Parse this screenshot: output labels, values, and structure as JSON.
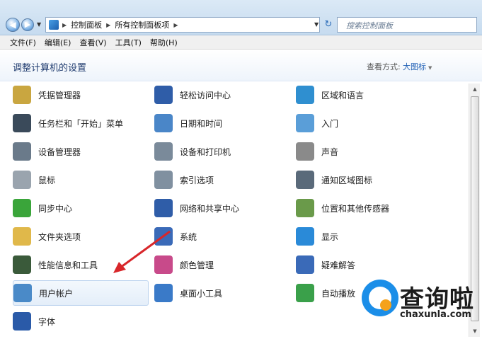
{
  "address_bar": {
    "crumbs": [
      "控制面板",
      "所有控制面板项"
    ],
    "search_placeholder": "搜索控制面板"
  },
  "menu": [
    "文件(F)",
    "编辑(E)",
    "查看(V)",
    "工具(T)",
    "帮助(H)"
  ],
  "header": {
    "title": "调整计算机的设置",
    "view_by_label": "查看方式:",
    "view_by_value": "大图标"
  },
  "items": [
    {
      "label": "凭据管理器",
      "icon": "credential-manager-icon",
      "color": "#c9a640"
    },
    {
      "label": "轻松访问中心",
      "icon": "ease-of-access-icon",
      "color": "#2f5da8"
    },
    {
      "label": "区域和语言",
      "icon": "region-language-icon",
      "color": "#2f8fd0"
    },
    {
      "label": "任务栏和「开始」菜单",
      "icon": "taskbar-start-icon",
      "color": "#3a4a5a"
    },
    {
      "label": "日期和时间",
      "icon": "date-time-icon",
      "color": "#4a86c8"
    },
    {
      "label": "入门",
      "icon": "getting-started-icon",
      "color": "#5a9ed8"
    },
    {
      "label": "设备管理器",
      "icon": "device-manager-icon",
      "color": "#6a7a8a"
    },
    {
      "label": "设备和打印机",
      "icon": "devices-printers-icon",
      "color": "#7a8a9a"
    },
    {
      "label": "声音",
      "icon": "sound-icon",
      "color": "#8a8a8a"
    },
    {
      "label": "鼠标",
      "icon": "mouse-icon",
      "color": "#9aa4ae"
    },
    {
      "label": "索引选项",
      "icon": "indexing-options-icon",
      "color": "#8090a0"
    },
    {
      "label": "通知区域图标",
      "icon": "notification-area-icon",
      "color": "#5a6a7a"
    },
    {
      "label": "同步中心",
      "icon": "sync-center-icon",
      "color": "#3aa53a"
    },
    {
      "label": "网络和共享中心",
      "icon": "network-sharing-icon",
      "color": "#2f5da8"
    },
    {
      "label": "位置和其他传感器",
      "icon": "location-sensors-icon",
      "color": "#6a9a4a"
    },
    {
      "label": "文件夹选项",
      "icon": "folder-options-icon",
      "color": "#e0b84a"
    },
    {
      "label": "系统",
      "icon": "system-icon",
      "color": "#3a6ab8"
    },
    {
      "label": "显示",
      "icon": "display-icon",
      "color": "#2a8ad8"
    },
    {
      "label": "性能信息和工具",
      "icon": "performance-icon",
      "color": "#3a5a3a"
    },
    {
      "label": "颜色管理",
      "icon": "color-management-icon",
      "color": "#c84a8a"
    },
    {
      "label": "疑难解答",
      "icon": "troubleshooting-icon",
      "color": "#3a6ab8"
    },
    {
      "label": "用户帐户",
      "icon": "user-accounts-icon",
      "color": "#4a8ac8"
    },
    {
      "label": "桌面小工具",
      "icon": "desktop-gadgets-icon",
      "color": "#3a7ac8"
    },
    {
      "label": "自动播放",
      "icon": "autoplay-icon",
      "color": "#3aa04a"
    },
    {
      "label": "字体",
      "icon": "fonts-icon",
      "color": "#2a5aa8"
    }
  ],
  "watermark": {
    "text": "查询啦",
    "url": "chaxunla.com"
  }
}
